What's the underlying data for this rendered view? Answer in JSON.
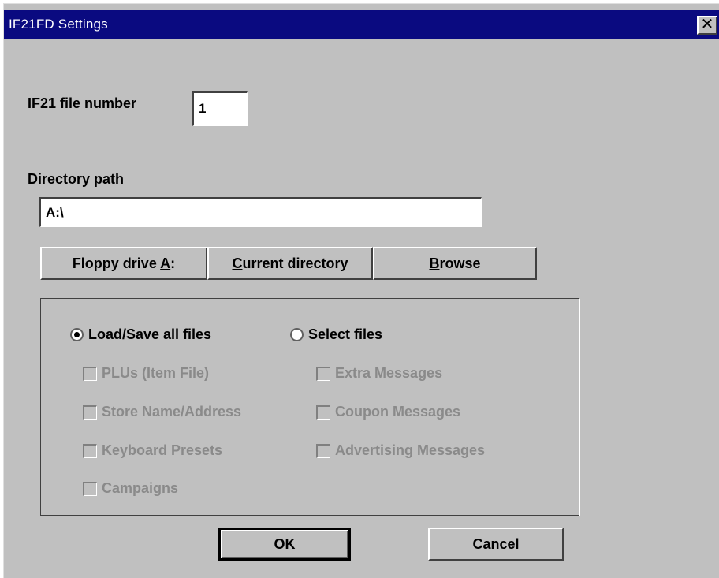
{
  "window": {
    "title": "IF21FD Settings",
    "close_glyph": "✕"
  },
  "file_number": {
    "label": "IF21 file number",
    "value": "1"
  },
  "directory": {
    "label": "Directory path",
    "value": "A:\\"
  },
  "buttons": {
    "floppy": "Floppy drive A:",
    "current_directory": "Current directory",
    "browse": "Browse",
    "ok": "OK",
    "cancel": "Cancel"
  },
  "mode": {
    "load_save_all": "Load/Save all files",
    "select_files": "Select files",
    "selected": "load_save_all"
  },
  "files": {
    "plus": "PLUs (Item File)",
    "store_name": "Store Name/Address",
    "keyboard_presets": "Keyboard Presets",
    "campaigns": "Campaigns",
    "extra_messages": "Extra Messages",
    "coupon_messages": "Coupon Messages",
    "advertising_messages": "Advertising Messages"
  },
  "colors": {
    "title_bar": "#0a0a80",
    "dialog_face": "#c0c0c0",
    "disabled_text": "#8a8a8a"
  }
}
